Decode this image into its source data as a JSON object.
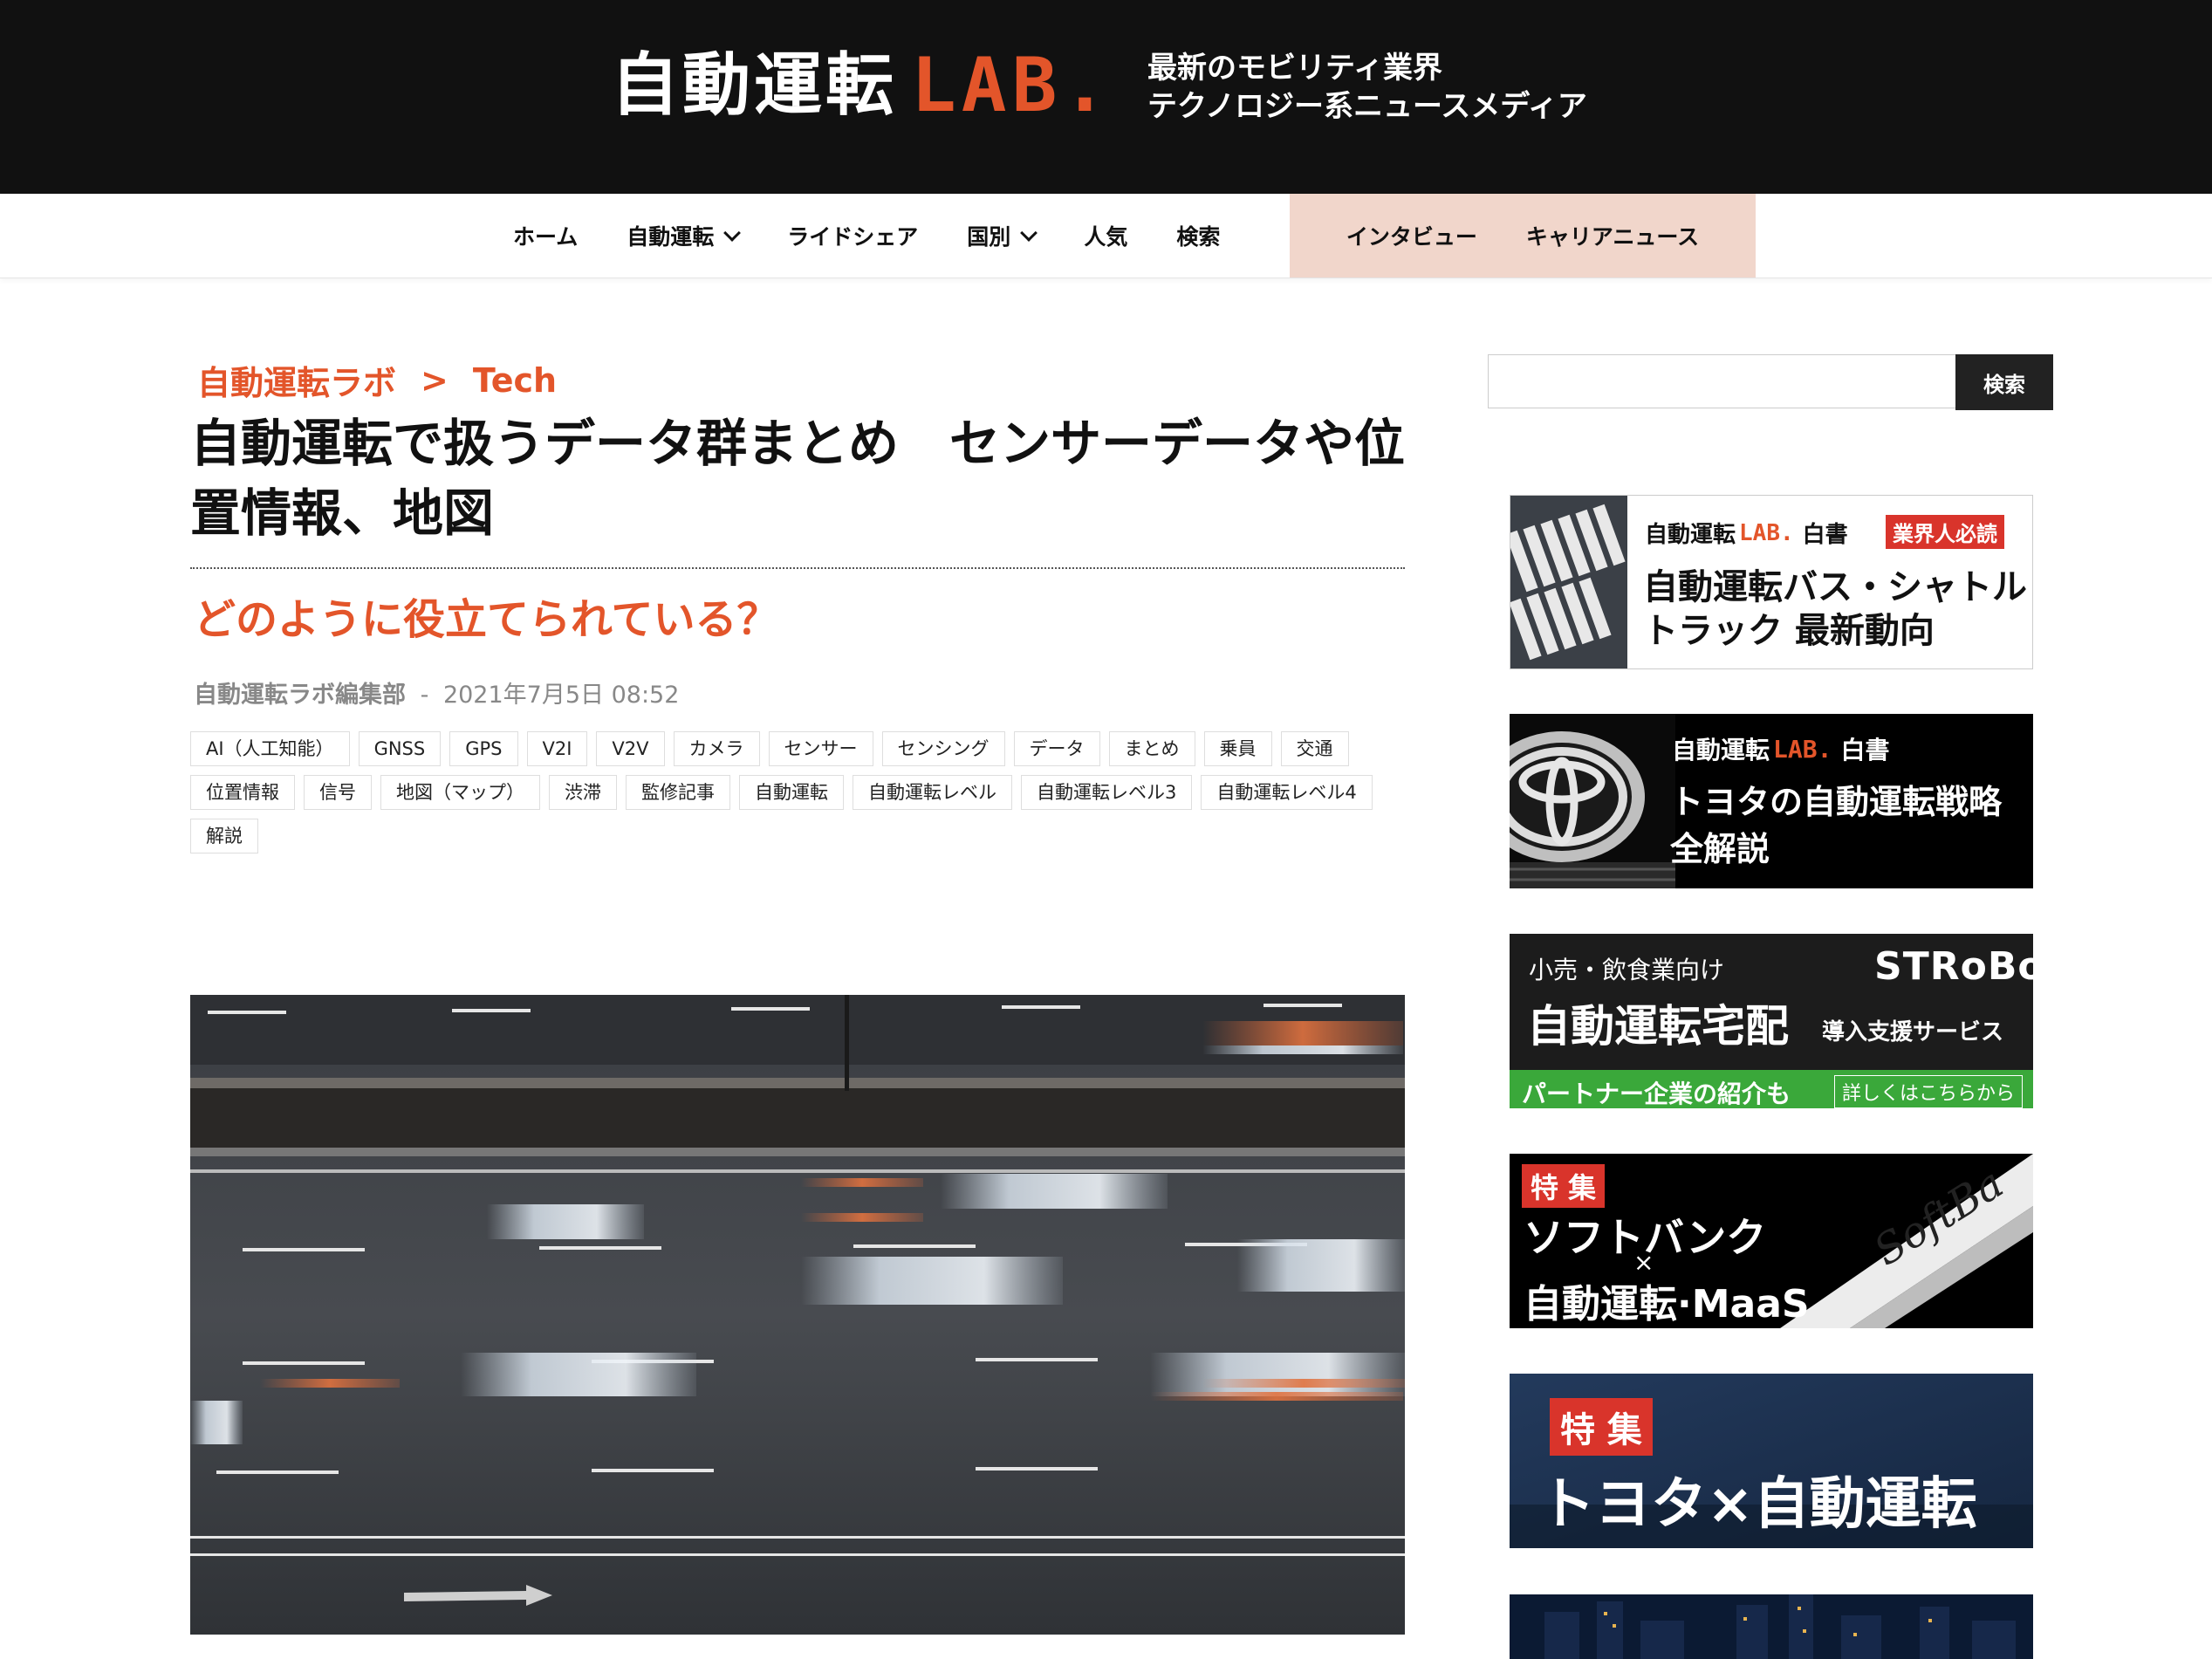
{
  "header": {
    "logo_text": "自動運転",
    "logo_lab": "LAB.",
    "tagline_line1": "最新のモビリティ業界",
    "tagline_line2": "テクノロジー系ニュースメディア"
  },
  "nav": {
    "items": [
      {
        "label": "ホーム"
      },
      {
        "label": "自動運転"
      },
      {
        "label": "ライドシェア"
      },
      {
        "label": "国別"
      },
      {
        "label": "人気"
      },
      {
        "label": "検索"
      }
    ],
    "highlight": [
      {
        "label": "インタビュー"
      },
      {
        "label": "キャリアニュース"
      }
    ]
  },
  "breadcrumb": {
    "home": "自動運転ラボ",
    "separator": ">",
    "current": "Tech"
  },
  "article": {
    "title": "自動運転で扱うデータ群まとめ　センサーデータや位置情報、地図",
    "subtitle": "どのように役立てられている？",
    "author": "自動運転ラボ編集部",
    "date_separator": "-",
    "date": "2021年7月5日 08:52",
    "tags": [
      "AI（人工知能）",
      "GNSS",
      "GPS",
      "V2I",
      "V2V",
      "カメラ",
      "センサー",
      "センシング",
      "データ",
      "まとめ",
      "乗員",
      "交通",
      "位置情報",
      "信号",
      "地図（マップ）",
      "渋滞",
      "監修記事",
      "自動運転",
      "自動運転レベル",
      "自動運転レベル3",
      "自動運転レベル4",
      "解説"
    ]
  },
  "sidebar": {
    "search_button": "検索",
    "search_value": "",
    "ads": [
      {
        "brand": "自動運転",
        "brand_lab": "LAB.",
        "kind": "白書",
        "badge": "業界人必読",
        "line1": "自動運転バス・シャトル",
        "line2": "トラック 最新動向"
      },
      {
        "brand": "自動運転",
        "brand_lab": "LAB.",
        "kind": "白書",
        "line1": "トヨタの自動運転戦略",
        "line2": "全解説"
      },
      {
        "kicker": "小売・飲食業向け",
        "logo": "STRoBo",
        "main": "自動運転宅配",
        "sub": "導入支援サービス",
        "bottom_left": "パートナー企業の紹介も",
        "bottom_right": "詳しくはこちらから"
      },
      {
        "badge": "特 集",
        "line1": "ソフトバンク",
        "cross": "×",
        "line2": "自動運転·MaaS",
        "sign": "SoftBa"
      },
      {
        "badge": "特 集",
        "main": "トヨタ×自動運転"
      }
    ]
  },
  "colors": {
    "accent": "#e3552a",
    "header_bg": "#111111",
    "nav_highlight": "#f1d6cb",
    "badge_red": "#d9342b",
    "ad_green": "#3aa83a"
  }
}
